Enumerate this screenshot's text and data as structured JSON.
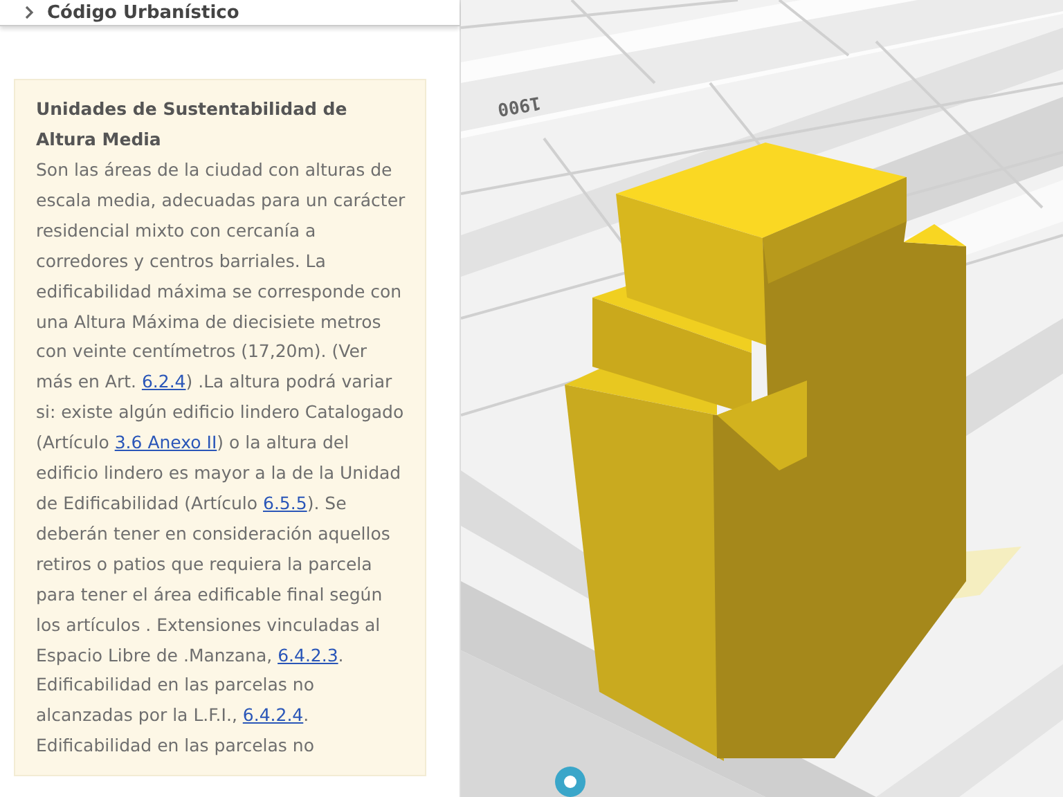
{
  "header": {
    "title": "Código Urbanístico"
  },
  "info_card": {
    "title": "Unidades de Sustentabilidad de Altura Media",
    "body": [
      {
        "kind": "text",
        "text": "Son las áreas de la ciudad con alturas de escala media, adecuadas para un carácter residencial mixto con cercanía a corredores y centros barriales. La edificabilidad máxima se corresponde con una Altura Máxima de diecisiete metros con veinte centímetros (17,20m). (Ver más en Art. "
      },
      {
        "kind": "link",
        "text": "6.2.4"
      },
      {
        "kind": "text",
        "text": ") .La altura podrá variar si: existe algún edificio lindero Catalogado (Artículo "
      },
      {
        "kind": "link",
        "text": "3.6 Anexo II"
      },
      {
        "kind": "text",
        "text": ") o la altura del edificio lindero es mayor a la de la Unidad de Edificabilidad (Artículo "
      },
      {
        "kind": "link",
        "text": "6.5.5"
      },
      {
        "kind": "text",
        "text": "). Se deberán tener en consideración aquellos retiros o patios que requiera la parcela para tener el área edificable final según los artículos . Extensiones vinculadas al Espacio Libre de .Manzana, "
      },
      {
        "kind": "link",
        "text": "6.4.2.3"
      },
      {
        "kind": "text",
        "text": ". Edificabilidad en las parcelas no alcanzadas por la L.F.I., "
      },
      {
        "kind": "link",
        "text": "6.4.2.4"
      },
      {
        "kind": "text",
        "text": ". Edificabilidad en las parcelas no"
      }
    ]
  },
  "map": {
    "street_label": "1900"
  }
}
